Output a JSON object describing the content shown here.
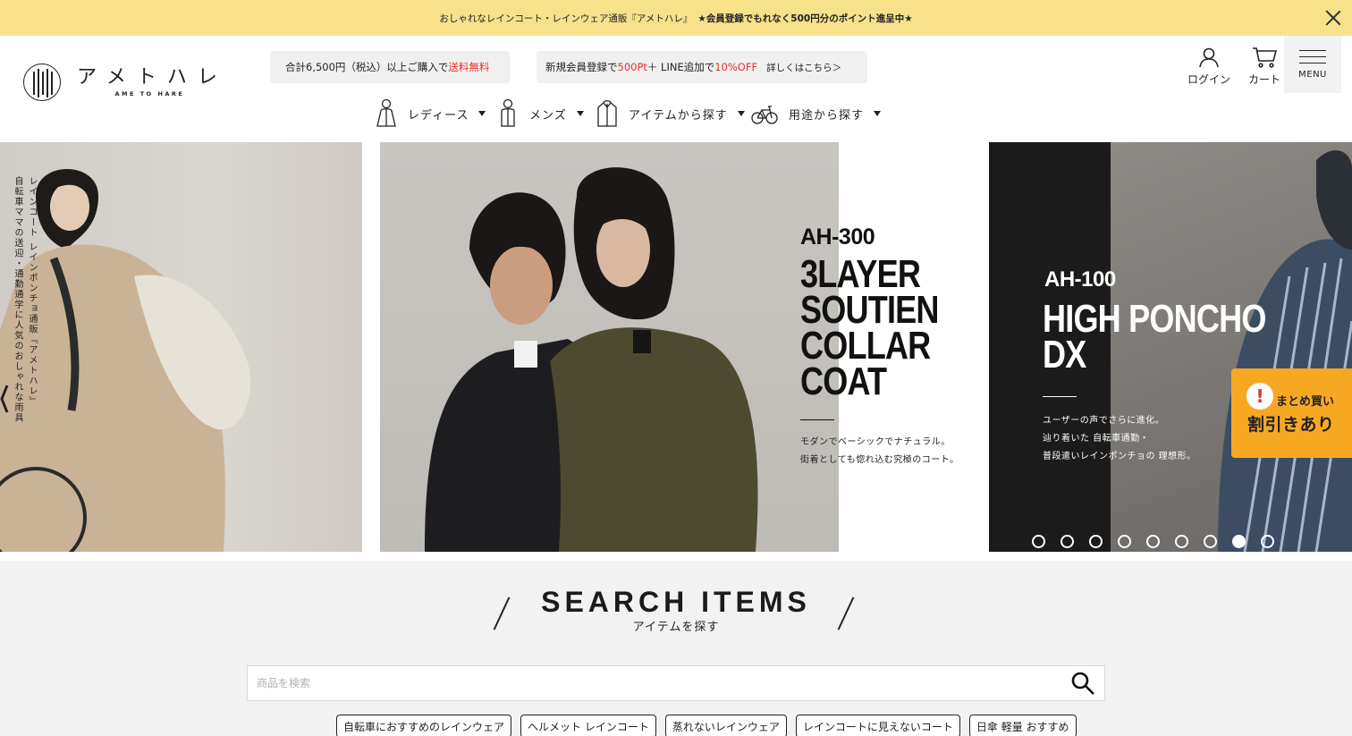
{
  "announcement": {
    "text": "おしゃれなレインコート・レインウェア通販『アメトハレ』",
    "highlight": "★会員登録でもれなく500円分のポイント進呈中★"
  },
  "header": {
    "logo_jp": "アメトハレ",
    "logo_en": "AME TO HARE",
    "promo_shipping": {
      "prefix": "合計6,500円（税込）以上ご購入で",
      "highlight": "送料無料"
    },
    "promo_member": {
      "part1": "新規会員登録で",
      "points": "500Pt",
      "part2": "＋ LINE追加で",
      "discount": "10%OFF",
      "more": "詳しくはこちら＞"
    },
    "login_label": "ログイン",
    "cart_label": "カート",
    "menu_label": "MENU"
  },
  "category_nav": [
    {
      "label": "レディース",
      "icon": "ladies-raincoat-icon"
    },
    {
      "label": "メンズ",
      "icon": "mens-raincoat-icon"
    },
    {
      "label": "アイテムから探す",
      "icon": "jacket-icon"
    },
    {
      "label": "用途から探す",
      "icon": "bicycle-icon"
    }
  ],
  "hero": {
    "left_copy_1": "レインコート レインポンチョ通販『アメトハレ』",
    "left_copy_2": "自転車ママの送迎・通勤通学に人気のおしゃれな雨具",
    "main_code": "AH-300",
    "main_title": [
      "3LAYER",
      "SOUTIEN",
      "COLLAR",
      "COAT"
    ],
    "main_desc": [
      "モダンでベーシックでナチュラル。",
      "街着としても惚れ込む究極のコート。"
    ],
    "right_code": "AH-100",
    "right_title": [
      "HIGH PONCHO",
      "DX"
    ],
    "right_desc": [
      "ユーザーの声でさらに進化。",
      "辿り着いた 自転車通勤・",
      "普段遣いレインポンチョの 理想形。"
    ],
    "active_dot": 8,
    "dot_count": 9
  },
  "bulk_badge": {
    "line1": "まとめ買い",
    "line2": "割引きあり"
  },
  "search_section": {
    "title": "SEARCH ITEMS",
    "subtitle": "アイテムを探す",
    "placeholder": "商品を検索",
    "tags": [
      "自転車におすすめのレインウェア",
      "ヘルメット レインコート",
      "蒸れないレインウェア",
      "レインコートに見えないコート",
      "日傘 軽量 おすすめ"
    ]
  },
  "colors": {
    "announce_bg": "#f7e18a",
    "accent_red": "#e8302a",
    "badge_orange": "#f7a823",
    "section_bg": "#f2f2f2"
  }
}
